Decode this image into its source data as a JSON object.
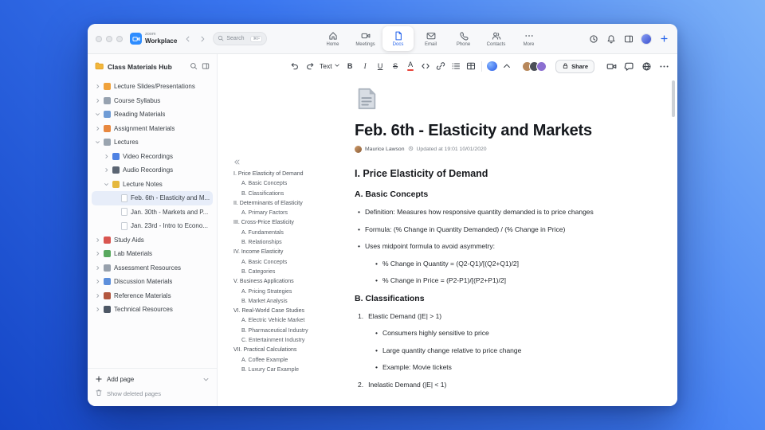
{
  "colors": {
    "accent_blue": "#2563eb"
  },
  "titlebar": {
    "brand_top": "zoom",
    "brand_bottom": "Workplace",
    "search_placeholder": "Search",
    "search_shortcut": "⌘F",
    "tabs": [
      {
        "label": "Home",
        "icon": "home-icon",
        "active": false
      },
      {
        "label": "Meetings",
        "icon": "meetings-camera-icon",
        "active": false
      },
      {
        "label": "Docs",
        "icon": "docs-icon",
        "active": true
      },
      {
        "label": "Email",
        "icon": "email-icon",
        "active": false
      },
      {
        "label": "Phone",
        "icon": "phone-icon",
        "active": false
      },
      {
        "label": "Contacts",
        "icon": "contacts-icon",
        "active": false
      },
      {
        "label": "More",
        "icon": "more-icon",
        "active": false
      }
    ],
    "right_icons": [
      "clock-icon",
      "bell-icon",
      "panel-icon",
      "user-avatar",
      "new-plus-button"
    ]
  },
  "sidebar": {
    "title": "Class Materials Hub",
    "header_icons": [
      "folder-icon",
      "search-icon",
      "panel-icon"
    ],
    "items": [
      {
        "label": "Lecture Slides/Presentations",
        "icon": "slides-icon",
        "color": "#f0a23c",
        "level": 0,
        "chevron": "right"
      },
      {
        "label": "Course Syllabus",
        "icon": "syllabus-icon",
        "color": "#97a2b0",
        "level": 0,
        "chevron": "right"
      },
      {
        "label": "Reading Materials",
        "icon": "book-icon",
        "color": "#6f9cd6",
        "level": 0,
        "chevron": "down"
      },
      {
        "label": "Assignment Materials",
        "icon": "assignment-icon",
        "color": "#e8883f",
        "level": 0,
        "chevron": "right"
      },
      {
        "label": "Lectures",
        "icon": "lectures-icon",
        "color": "#9aa4af",
        "level": 0,
        "chevron": "down"
      },
      {
        "label": "Video Recordings",
        "icon": "video-icon",
        "color": "#4f82e3",
        "level": 1,
        "chevron": "right"
      },
      {
        "label": "Audio Recordings",
        "icon": "audio-icon",
        "color": "#5b6573",
        "level": 1,
        "chevron": "right"
      },
      {
        "label": "Lecture Notes",
        "icon": "notes-icon",
        "color": "#e5b83e",
        "level": 1,
        "chevron": "down"
      },
      {
        "label": "Feb. 6th - Elasticity and M...",
        "icon": "page-icon",
        "color": "page",
        "level": 2,
        "selected": true
      },
      {
        "label": "Jan. 30th - Markets and P...",
        "icon": "page-icon",
        "color": "page",
        "level": 2
      },
      {
        "label": "Jan. 23rd - Intro to Econo...",
        "icon": "page-icon",
        "color": "page",
        "level": 2
      },
      {
        "label": "Study Aids",
        "icon": "study-icon",
        "color": "#d95550",
        "level": 0,
        "chevron": "right"
      },
      {
        "label": "Lab Materials",
        "icon": "lab-icon",
        "color": "#58a85e",
        "level": 0,
        "chevron": "right"
      },
      {
        "label": "Assessment Resources",
        "icon": "assessment-icon",
        "color": "#97a0ac",
        "level": 0,
        "chevron": "right"
      },
      {
        "label": "Discussion Materials",
        "icon": "discussion-icon",
        "color": "#5d8fdb",
        "level": 0,
        "chevron": "right"
      },
      {
        "label": "Reference Materials",
        "icon": "reference-icon",
        "color": "#b2563f",
        "level": 0,
        "chevron": "right"
      },
      {
        "label": "Technical Resources",
        "icon": "technical-icon",
        "color": "#4d5765",
        "level": 0,
        "chevron": "right"
      }
    ],
    "footer": {
      "add_page": "Add page",
      "show_deleted_pages": "Show deleted pages"
    }
  },
  "toolbar": {
    "text_style_label": "Text",
    "share_label": "Share",
    "glyphs": {
      "bold": "B",
      "italic": "I",
      "underline": "U",
      "strikethrough": "S",
      "color": "A"
    },
    "icons": [
      "undo-icon",
      "redo-icon",
      "text-color-icon",
      "code-icon",
      "link-icon",
      "bullet-list-icon",
      "table-icon",
      "ai-companion-icon",
      "collapse-toolbar-icon",
      "lock-icon",
      "video-camera-icon",
      "comment-icon",
      "language-icon",
      "more-icon"
    ],
    "avatar_colors": [
      "#b7875a",
      "#4b4f58",
      "#8b6fd1"
    ]
  },
  "document": {
    "title": "Feb. 6th - Elasticity and Markets",
    "author": "Maurice Lawson",
    "updated": "Updated at 19:01 10/01/2020",
    "outline": [
      {
        "label": "I. Price Elasticity of Demand",
        "level": 0
      },
      {
        "label": "A. Basic Concepts",
        "level": 1
      },
      {
        "label": "B. Classifications",
        "level": 1
      },
      {
        "label": "II. Determinants of Elasticity",
        "level": 0
      },
      {
        "label": "A. Primary Factors",
        "level": 1
      },
      {
        "label": "III. Cross-Price Elasticity",
        "level": 0
      },
      {
        "label": "A. Fundamentals",
        "level": 1
      },
      {
        "label": "B. Relationships",
        "level": 1
      },
      {
        "label": "IV. Income Elasticity",
        "level": 0
      },
      {
        "label": "A. Basic Concepts",
        "level": 1
      },
      {
        "label": "B. Categories",
        "level": 1
      },
      {
        "label": "V. Business Applications",
        "level": 0
      },
      {
        "label": "A. Pricing Strategies",
        "level": 1
      },
      {
        "label": "B. Market Analysis",
        "level": 1
      },
      {
        "label": "VI. Real-World Case Studies",
        "level": 0
      },
      {
        "label": "A. Electric Vehicle Market",
        "level": 1
      },
      {
        "label": "B. Pharmaceutical Industry",
        "level": 1
      },
      {
        "label": "C. Entertainment Industry",
        "level": 1
      },
      {
        "label": "VII. Practical Calculations",
        "level": 0
      },
      {
        "label": "A. Coffee Example",
        "level": 1
      },
      {
        "label": "B. Luxury Car Example",
        "level": 1
      }
    ],
    "content": [
      {
        "type": "h2",
        "text": "I. Price Elasticity of Demand"
      },
      {
        "type": "h3",
        "text": "A. Basic Concepts"
      },
      {
        "type": "bullet",
        "text": "Definition: Measures how responsive quantity demanded is to price changes"
      },
      {
        "type": "bullet",
        "text": "Formula: (% Change in Quantity Demanded) / (% Change in Price)"
      },
      {
        "type": "bullet",
        "text": "Uses midpoint formula to avoid asymmetry:"
      },
      {
        "type": "bullet2",
        "text": "% Change in Quantity = (Q2-Q1)/[(Q2+Q1)/2]"
      },
      {
        "type": "bullet2",
        "text": "% Change in Price = (P2-P1)/[(P2+P1)/2]"
      },
      {
        "type": "h3",
        "text": "B. Classifications"
      },
      {
        "type": "num",
        "num": "1.",
        "text": "Elastic Demand (|E| > 1)"
      },
      {
        "type": "bullet2",
        "text": "Consumers highly sensitive to price"
      },
      {
        "type": "bullet2",
        "text": "Large quantity change relative to price change"
      },
      {
        "type": "bullet2",
        "text": "Example: Movie tickets"
      },
      {
        "type": "num",
        "num": "2.",
        "text": "Inelastic Demand (|E| < 1)"
      }
    ]
  }
}
